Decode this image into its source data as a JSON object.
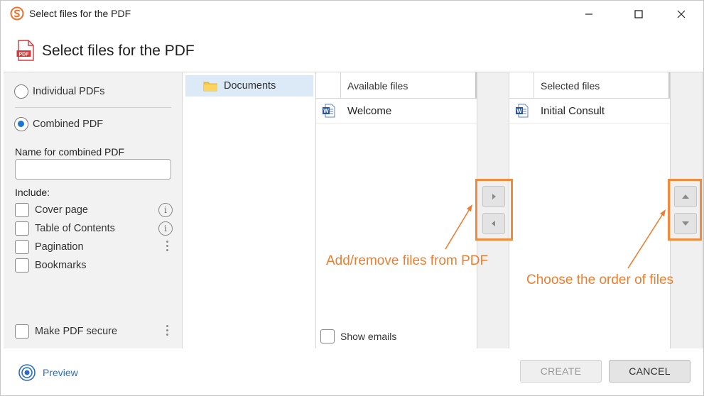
{
  "window": {
    "title": "Select files for the PDF"
  },
  "header": {
    "title": "Select files for the PDF",
    "icon": "pdf-file-icon",
    "icon_text": "PDF"
  },
  "options": {
    "individual_label": "Individual PDFs",
    "combined_label": "Combined PDF",
    "selected_mode": "combined",
    "name_label": "Name for combined PDF",
    "name_value": "",
    "include_label": "Include:",
    "include_items": [
      {
        "label": "Cover page",
        "checked": false,
        "icon": "info-icon"
      },
      {
        "label": "Table of Contents",
        "checked": false,
        "icon": "info-icon"
      },
      {
        "label": "Pagination",
        "checked": false,
        "icon": "kebab-menu-icon"
      },
      {
        "label": "Bookmarks",
        "checked": false,
        "icon": ""
      }
    ],
    "secure_label": "Make PDF secure",
    "secure_checked": false
  },
  "folders": {
    "items": [
      {
        "label": "Documents",
        "selected": true
      }
    ]
  },
  "available": {
    "header": "Available files",
    "files": [
      {
        "name": "Welcome",
        "icon": "word-doc-icon"
      }
    ],
    "show_emails_label": "Show emails",
    "show_emails_checked": false
  },
  "selected": {
    "header": "Selected files",
    "files": [
      {
        "name": "Initial Consult",
        "icon": "word-doc-icon"
      }
    ]
  },
  "annotations": {
    "add_remove": "Add/remove files from PDF",
    "order": "Choose the order of files",
    "color": "#ef7d2f"
  },
  "footer": {
    "preview_label": "Preview",
    "create_label": "CREATE",
    "create_enabled": false,
    "cancel_label": "CANCEL"
  },
  "colors": {
    "accent": "#1a73d9",
    "highlight": "#f08a3c",
    "folder_selected_bg": "#dce9f7",
    "panel_bg": "#f2f2f2"
  }
}
